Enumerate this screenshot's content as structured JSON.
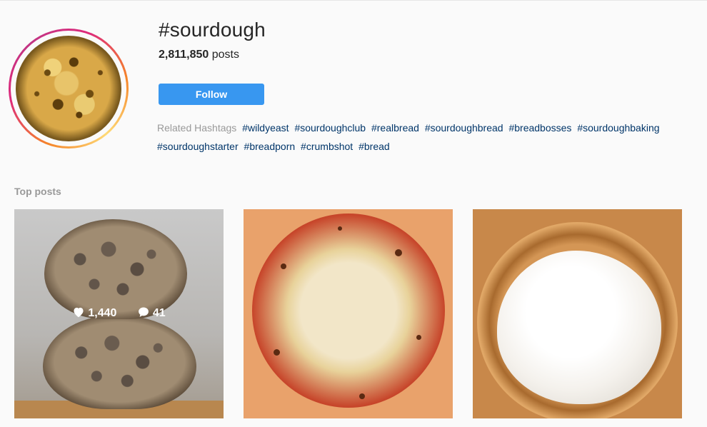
{
  "hashtag": {
    "title": "#sourdough",
    "post_count": "2,811,850",
    "posts_word": "posts",
    "follow_label": "Follow"
  },
  "related": {
    "label": "Related Hashtags",
    "tags": [
      "#wildyeast",
      "#sourdoughclub",
      "#realbread",
      "#sourdoughbread",
      "#breadbosses",
      "#sourdoughbaking",
      "#sourdoughstarter",
      "#breadporn",
      "#crumbshot",
      "#bread"
    ]
  },
  "top_posts": {
    "title": "Top posts",
    "posts": [
      {
        "subject": "sliced sourdough loaf",
        "likes": "1,440",
        "comments": "41"
      },
      {
        "subject": "pizza"
      },
      {
        "subject": "dough in bowl"
      }
    ]
  },
  "colors": {
    "follow_button": "#3897f0",
    "hashtag_link": "#003569",
    "muted_text": "#999999"
  },
  "icons": {
    "likes": "heart-icon",
    "comments": "comment-bubble-icon"
  }
}
